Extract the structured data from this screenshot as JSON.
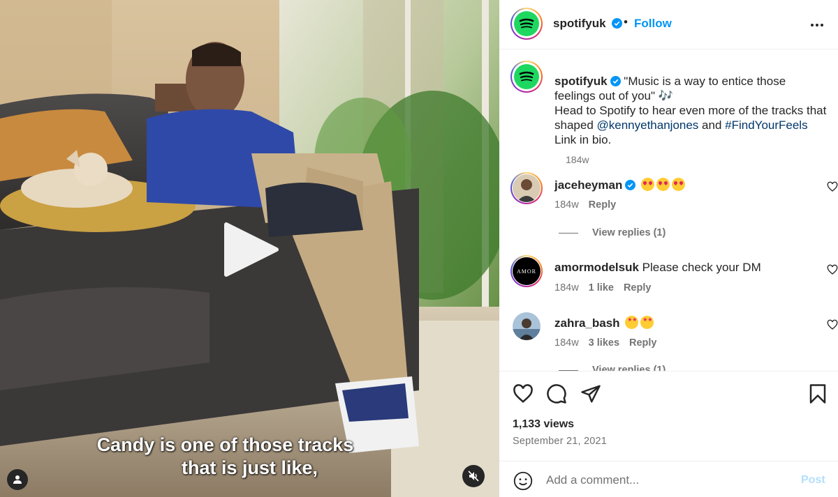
{
  "video": {
    "caption_line1": "Candy is one of those tracks",
    "caption_line2": "that is just like,",
    "play_icon": "play-icon",
    "user_tag_icon": "user-icon",
    "mute_icon": "volume-muted-icon"
  },
  "header": {
    "username": "spotifyuk",
    "separator": "•",
    "follow_label": "Follow",
    "more_icon": "ellipsis-icon"
  },
  "post_caption": {
    "username": "spotifyuk",
    "quote": "\"Music is a way to entice those feelings out of you\" 🎶",
    "line2_prefix": "Head to Spotify to hear even more of the tracks that shaped ",
    "mention": "@kennyethanjones",
    "and": " and",
    "hashtag": "#FindYourFeels",
    "suffix": " Link in bio.",
    "time": "184w"
  },
  "comments": [
    {
      "username": "jaceheyman",
      "verified": true,
      "text": "",
      "time": "184w",
      "likes": "",
      "reply_label": "Reply",
      "view_replies": "View replies (1)"
    },
    {
      "username": "amormodelsuk",
      "verified": false,
      "text": "Please check your DM",
      "time": "184w",
      "likes": "1 like",
      "reply_label": "Reply",
      "avatar_text": "AMOR"
    },
    {
      "username": "zahra_bash",
      "verified": false,
      "text": "",
      "time": "184w",
      "likes": "3 likes",
      "reply_label": "Reply",
      "view_replies": "View replies (1)"
    }
  ],
  "actions": {
    "views": "1,133 views",
    "date": "September 21, 2021",
    "comment_placeholder": "Add a comment...",
    "post_label": "Post"
  },
  "colors": {
    "accent": "#0095f6",
    "spotify_green": "#1ed760",
    "link": "#00376b",
    "muted": "#737373",
    "post_disabled": "#b2dffc"
  }
}
